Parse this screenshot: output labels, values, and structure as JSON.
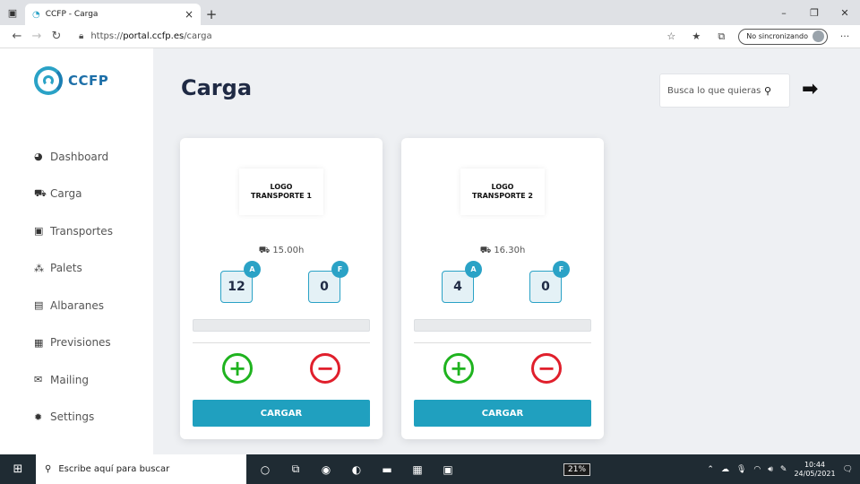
{
  "browser": {
    "tab_title": "CCFP - Carga",
    "tab_close": "×",
    "new_tab": "+",
    "url_scheme": "https://",
    "url_host": "portal.ccfp.es",
    "url_path": "/carga",
    "sync_label": "No sincronizando",
    "window_controls": {
      "minimize": "–",
      "restore": "❐",
      "close": "✕"
    }
  },
  "app": {
    "logo_text": "CCFP",
    "brand_color": "#2aa2c6",
    "page_title": "Carga",
    "search_placeholder": "Busca lo que quieras",
    "sidebar": {
      "items": [
        {
          "label": "Dashboard",
          "icon": "dashboard-icon",
          "glyph": "◕"
        },
        {
          "label": "Carga",
          "icon": "truck-icon",
          "glyph": "⛟"
        },
        {
          "label": "Transportes",
          "icon": "id-card-icon",
          "glyph": "▣"
        },
        {
          "label": "Palets",
          "icon": "boxes-icon",
          "glyph": "⁂"
        },
        {
          "label": "Albaranes",
          "icon": "document-icon",
          "glyph": "▤"
        },
        {
          "label": "Previsiones",
          "icon": "calculator-icon",
          "glyph": "▦"
        },
        {
          "label": "Mailing",
          "icon": "envelope-icon",
          "glyph": "✉"
        },
        {
          "label": "Settings",
          "icon": "gear-icon",
          "glyph": "✹"
        }
      ]
    },
    "cards": [
      {
        "logo_text": "LOGO\nTRANSPORTE 1",
        "time": "15.00h",
        "badge_a": "A",
        "count_a": "12",
        "badge_f": "F",
        "count_f": "0",
        "progress": 0,
        "plus": "+",
        "minus": "−",
        "button_label": "CARGAR"
      },
      {
        "logo_text": "LOGO\nTRANSPORTE 2",
        "time": "16.30h",
        "badge_a": "A",
        "count_a": "4",
        "badge_f": "F",
        "count_f": "0",
        "progress": 0,
        "plus": "+",
        "minus": "−",
        "button_label": "CARGAR"
      }
    ]
  },
  "taskbar": {
    "search_text": "Escribe aquí para buscar",
    "battery": "21%",
    "time": "10:44",
    "date": "24/05/2021"
  }
}
